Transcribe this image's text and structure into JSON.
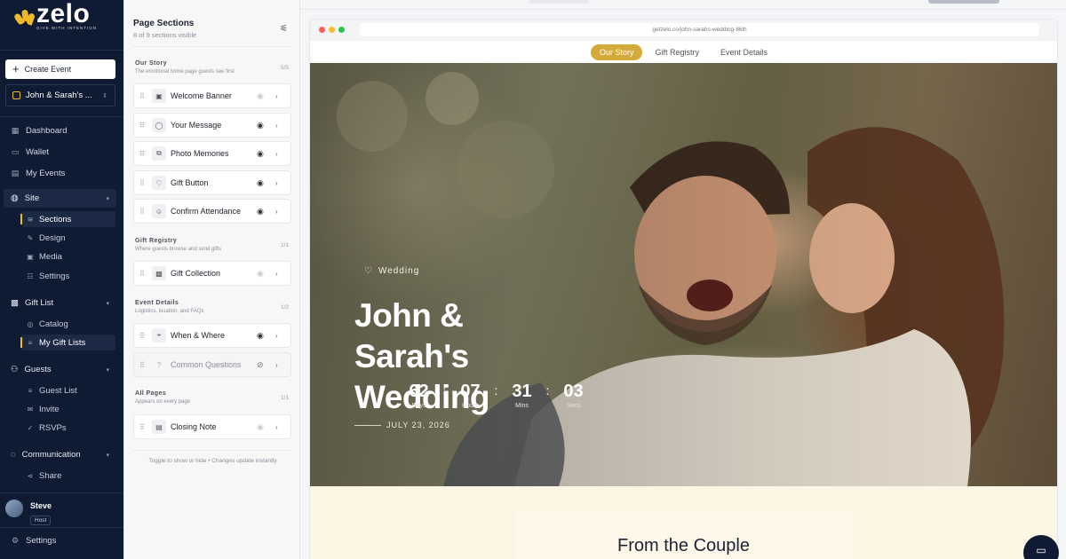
{
  "brand": {
    "name": "zelo",
    "tagline": "GIVE WITH INTENTION",
    "accent": "#f0b929"
  },
  "nav": {
    "create_event": "Create Event",
    "event_selector": "John & Sarah's ...",
    "dashboard": "Dashboard",
    "wallet": "Wallet",
    "my_events": "My Events",
    "site": {
      "label": "Site",
      "items": [
        "Sections",
        "Design",
        "Media",
        "Settings"
      ]
    },
    "gift_list": {
      "label": "Gift List",
      "items": [
        "Catalog",
        "My Gift Lists"
      ]
    },
    "guests": {
      "label": "Guests",
      "items": [
        "Guest List",
        "Invite",
        "RSVPs"
      ]
    },
    "communication": {
      "label": "Communication",
      "items": [
        "Share"
      ]
    },
    "user": {
      "name": "Steve",
      "role": "Host"
    },
    "settings": "Settings"
  },
  "panel": {
    "title": "Page Sections",
    "subtitle": "8 of 9 sections visible",
    "groups": [
      {
        "title": "Our Story",
        "desc": "The emotional home page guests see first",
        "count": "5/5",
        "rows": [
          {
            "label": "Welcome Banner",
            "icon": "image-icon",
            "visible": true
          },
          {
            "label": "Your Message",
            "icon": "message-icon",
            "visible": true
          },
          {
            "label": "Photo Memories",
            "icon": "gallery-icon",
            "visible": true
          },
          {
            "label": "Gift Button",
            "icon": "heart-icon",
            "visible": true
          },
          {
            "label": "Confirm Attendance",
            "icon": "user-check-icon",
            "visible": true
          }
        ]
      },
      {
        "title": "Gift Registry",
        "desc": "Where guests browse and send gifts",
        "count": "1/1",
        "rows": [
          {
            "label": "Gift Collection",
            "icon": "gift-icon",
            "visible": true
          }
        ]
      },
      {
        "title": "Event Details",
        "desc": "Logistics, location, and FAQs",
        "count": "1/2",
        "rows": [
          {
            "label": "When & Where",
            "icon": "pin-icon",
            "visible": true
          },
          {
            "label": "Common Questions",
            "icon": "help-icon",
            "visible": false
          }
        ]
      },
      {
        "title": "All Pages",
        "desc": "Appears on every page",
        "count": "1/1",
        "rows": [
          {
            "label": "Closing Note",
            "icon": "note-icon",
            "visible": true
          }
        ]
      }
    ],
    "footer": "Toggle to show or hide • Changes update instantly"
  },
  "preview": {
    "url": "getzelo.co/john-sarahs-wedding-86lh",
    "tabs": [
      "Our Story",
      "Gift Registry",
      "Event Details"
    ],
    "active_tab": "Our Story",
    "hero": {
      "tag": "Wedding",
      "title": "John & Sarah's Wedding",
      "countdown": [
        {
          "value": "62",
          "label": "Days"
        },
        {
          "value": "07",
          "label": "Hours"
        },
        {
          "value": "31",
          "label": "Mins"
        },
        {
          "value": "03",
          "label": "Secs"
        }
      ],
      "date": "July 23, 2026"
    },
    "couple_heading": "From the Couple"
  }
}
